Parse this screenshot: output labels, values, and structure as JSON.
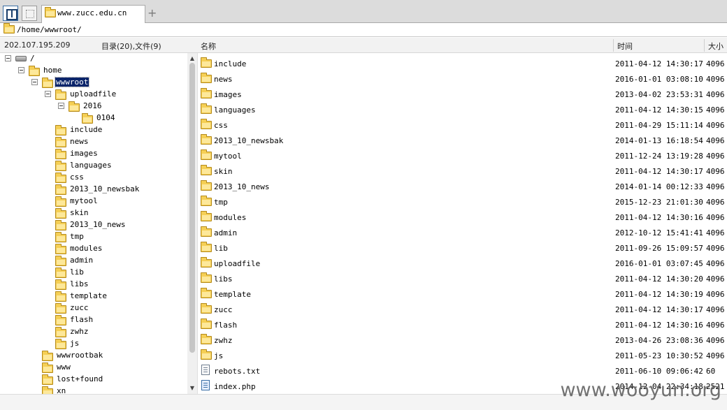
{
  "tabbar": {
    "tab_title": "www.zucc.edu.cn",
    "add_tab_label": "+"
  },
  "address": {
    "path": "/home/wwwroot/"
  },
  "header": {
    "host": "202.107.195.209",
    "counts": "目录(20),文件(9)",
    "col_name": "名称",
    "col_time": "时间",
    "col_size": "大小"
  },
  "tree": {
    "root": "/",
    "home": "home",
    "wwwroot": "wwwroot",
    "uploadfile": "uploadfile",
    "y2016": "2016",
    "d0104": "0104",
    "children": [
      "include",
      "news",
      "images",
      "languages",
      "css",
      "2013_10_newsbak",
      "mytool",
      "skin",
      "2013_10_news",
      "tmp",
      "modules",
      "admin",
      "lib",
      "libs",
      "template",
      "zucc",
      "flash",
      "zwhz",
      "js"
    ],
    "siblings": [
      "wwwrootbak",
      "www",
      "lost+found",
      "xn"
    ]
  },
  "scrollbar": {
    "up_arrow": "▲",
    "down_arrow": "▼"
  },
  "files": [
    {
      "name": "include",
      "time": "2011-04-12 14:30:17",
      "size": "4096",
      "type": "folder"
    },
    {
      "name": "news",
      "time": "2016-01-01 03:08:10",
      "size": "4096",
      "type": "folder"
    },
    {
      "name": "images",
      "time": "2013-04-02 23:53:31",
      "size": "4096",
      "type": "folder"
    },
    {
      "name": "languages",
      "time": "2011-04-12 14:30:15",
      "size": "4096",
      "type": "folder"
    },
    {
      "name": "css",
      "time": "2011-04-29 15:11:14",
      "size": "4096",
      "type": "folder"
    },
    {
      "name": "2013_10_newsbak",
      "time": "2014-01-13 16:18:54",
      "size": "4096",
      "type": "folder"
    },
    {
      "name": "mytool",
      "time": "2011-12-24 13:19:28",
      "size": "4096",
      "type": "folder"
    },
    {
      "name": "skin",
      "time": "2011-04-12 14:30:17",
      "size": "4096",
      "type": "folder"
    },
    {
      "name": "2013_10_news",
      "time": "2014-01-14 00:12:33",
      "size": "4096",
      "type": "folder"
    },
    {
      "name": "tmp",
      "time": "2015-12-23 21:01:30",
      "size": "4096",
      "type": "folder"
    },
    {
      "name": "modules",
      "time": "2011-04-12 14:30:16",
      "size": "4096",
      "type": "folder"
    },
    {
      "name": "admin",
      "time": "2012-10-12 15:41:41",
      "size": "4096",
      "type": "folder"
    },
    {
      "name": "lib",
      "time": "2011-09-26 15:09:57",
      "size": "4096",
      "type": "folder"
    },
    {
      "name": "uploadfile",
      "time": "2016-01-01 03:07:45",
      "size": "4096",
      "type": "folder"
    },
    {
      "name": "libs",
      "time": "2011-04-12 14:30:20",
      "size": "4096",
      "type": "folder"
    },
    {
      "name": "template",
      "time": "2011-04-12 14:30:19",
      "size": "4096",
      "type": "folder"
    },
    {
      "name": "zucc",
      "time": "2011-04-12 14:30:17",
      "size": "4096",
      "type": "folder"
    },
    {
      "name": "flash",
      "time": "2011-04-12 14:30:16",
      "size": "4096",
      "type": "folder"
    },
    {
      "name": "zwhz",
      "time": "2013-04-26 23:08:36",
      "size": "4096",
      "type": "folder"
    },
    {
      "name": "js",
      "time": "2011-05-23 10:30:52",
      "size": "4096",
      "type": "folder"
    },
    {
      "name": "rebots.txt",
      "time": "2011-06-10 09:06:42",
      "size": "60",
      "type": "text-file"
    },
    {
      "name": "index.php",
      "time": "2014-12-04 22:34:18",
      "size": "2521",
      "type": "php-file"
    }
  ],
  "watermark": "www.wooyun.org"
}
